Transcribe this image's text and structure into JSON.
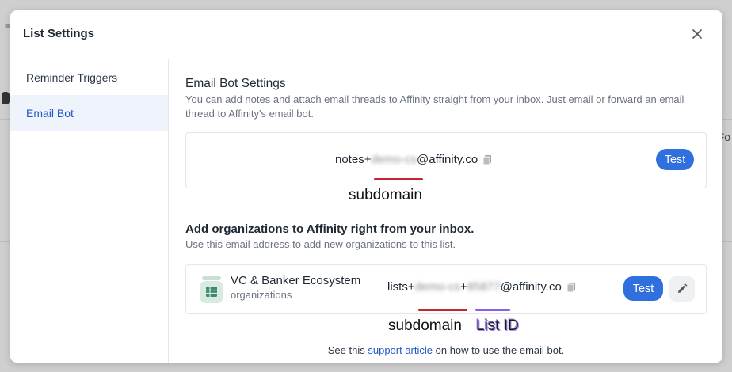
{
  "modal": {
    "title": "List Settings"
  },
  "sidebar": {
    "items": [
      {
        "label": "Reminder Triggers",
        "active": false
      },
      {
        "label": "Email Bot",
        "active": true
      }
    ]
  },
  "email_bot": {
    "title": "Email Bot Settings",
    "description": "You can add notes and attach email threads to Affinity straight from your inbox. Just email or forward an email thread to Affinity's email bot.",
    "address_prefix": "notes+",
    "address_subdomain": "demo-cs",
    "address_domain": "@affinity.co",
    "test_label": "Test",
    "subdomain_annotation": "subdomain"
  },
  "organizations": {
    "title": "Add organizations to Affinity right from your inbox.",
    "description": "Use this email address to add new organizations to this list.",
    "list_name": "VC & Banker Ecosystem",
    "list_type": "organizations",
    "address_prefix": "lists+",
    "address_subdomain": "demo-cs",
    "address_plus": "+",
    "address_list_id": "85877",
    "address_domain": "@affinity.co",
    "test_label": "Test",
    "subdomain_annotation": "subdomain",
    "list_id_annotation": "List ID"
  },
  "footer": {
    "prefix": "See this ",
    "link_text": "support article",
    "suffix": " on how to use the email bot."
  },
  "backdrop": {
    "edge_text": "Fo",
    "left_mark": "≡"
  },
  "colors": {
    "accent": "#2f6fde",
    "active_bg": "#eef3fc",
    "subdomain_underline": "#c0262d",
    "list_id_underline": "#8a5cf0",
    "list_icon_green": "#3d8a6a"
  },
  "icons": {
    "close": "close-icon",
    "copy": "copy-icon",
    "edit": "pencil-icon",
    "list": "list-sheet-icon"
  }
}
